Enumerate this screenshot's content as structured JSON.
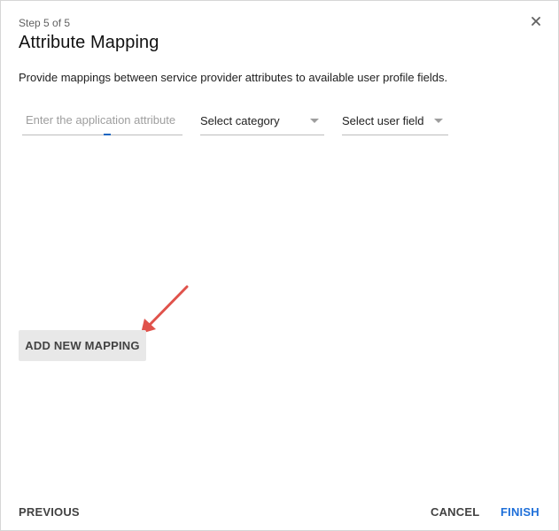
{
  "dialog": {
    "step": "Step 5 of 5",
    "title": "Attribute Mapping",
    "description": "Provide mappings between service provider attributes to available user profile fields."
  },
  "mapping_row": {
    "attribute_input": {
      "placeholder": "Enter the application attribute",
      "value": ""
    },
    "category_select": {
      "selected": "Select category"
    },
    "user_field_select": {
      "selected": "Select user field"
    }
  },
  "actions": {
    "add_mapping": "ADD NEW MAPPING",
    "previous": "PREVIOUS",
    "cancel": "CANCEL",
    "finish": "FINISH"
  },
  "colors": {
    "accent": "#1e6fd9",
    "annotation_arrow": "#e0524b",
    "button_bg": "#e8e8e8"
  },
  "icons": {
    "close": "close-icon",
    "dropdown": "chevron-down-icon",
    "annotation": "annotation-arrow-icon"
  }
}
